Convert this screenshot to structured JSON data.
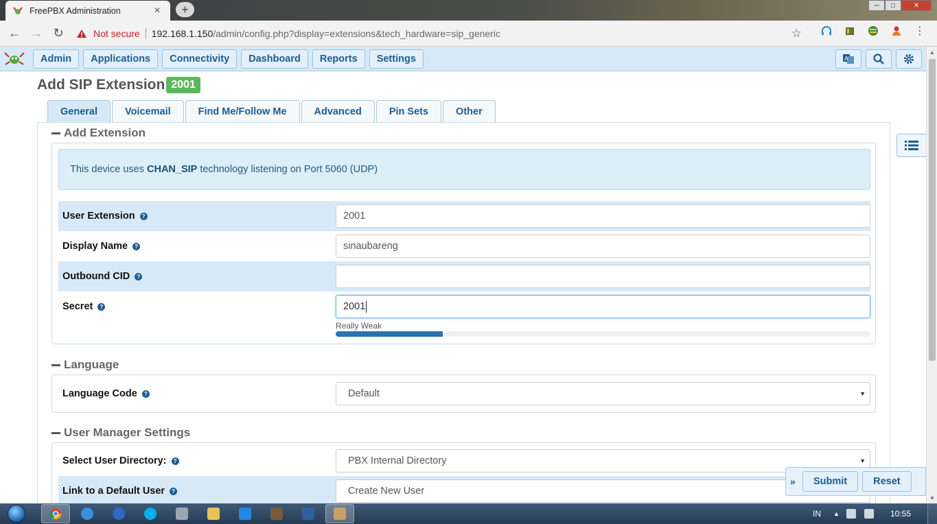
{
  "browser": {
    "tab_title": "FreePBX Administration",
    "tab_close": "×",
    "new_tab": "+",
    "security": "Not secure",
    "url_host": "192.168.1.150",
    "url_path": "/admin/config.php?display=extensions&tech_hardware=sip_generic"
  },
  "nav": {
    "menu": [
      "Admin",
      "Applications",
      "Connectivity",
      "Dashboard",
      "Reports",
      "Settings"
    ]
  },
  "page": {
    "title": "Add SIP Extension",
    "extension_badge": "2001",
    "tabs": [
      "General",
      "Voicemail",
      "Find Me/Follow Me",
      "Advanced",
      "Pin Sets",
      "Other"
    ],
    "active_tab": "General"
  },
  "add_extension": {
    "heading": "Add Extension",
    "info_prefix": "This device uses",
    "info_tech": "CHAN_SIP",
    "info_suffix": "technology listening on Port 5060 (UDP)",
    "fields": {
      "user_extension": {
        "label": "User Extension",
        "value": "2001"
      },
      "display_name": {
        "label": "Display Name",
        "value": "sinaubareng"
      },
      "outbound_cid": {
        "label": "Outbound CID",
        "value": ""
      },
      "secret": {
        "label": "Secret",
        "value": "2001"
      }
    },
    "strength": {
      "label": "Really Weak",
      "fraction": 0.2
    }
  },
  "language": {
    "heading": "Language",
    "code_label": "Language Code",
    "code_value": "Default"
  },
  "user_manager": {
    "heading": "User Manager Settings",
    "directory_label": "Select User Directory:",
    "directory_value": "PBX Internal Directory",
    "default_user_label": "Link to a Default User",
    "default_user_value": "Create New User"
  },
  "actions": {
    "toggle": "»",
    "submit": "Submit",
    "reset": "Reset"
  },
  "help_glyph": "?",
  "taskbar": {
    "lang": "IN",
    "clock": "10:55"
  },
  "colors": {
    "accent": "#1d5c91",
    "nav_bg": "#d7e9f7",
    "badge": "#5cb85c",
    "strength_fill": "#2a72b0",
    "warning": "#c5221f"
  }
}
